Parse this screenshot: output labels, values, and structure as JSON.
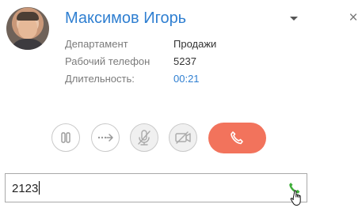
{
  "contact": {
    "name": "Максимов Игорь",
    "fields": [
      {
        "label": "Департамент",
        "value": "Продажи"
      },
      {
        "label": "Рабочий телефон",
        "value": "5237"
      },
      {
        "label": "Длительность:",
        "value": "00:21"
      }
    ]
  },
  "controls": [
    {
      "icon": "pause-icon"
    },
    {
      "icon": "transfer-icon"
    },
    {
      "icon": "mic-off-icon"
    },
    {
      "icon": "video-off-icon"
    },
    {
      "icon": "hangup-icon"
    }
  ],
  "dial": {
    "value": "2123"
  },
  "colors": {
    "accent": "#2f7fd1",
    "hangup": "#f2735c",
    "call_icon": "#3fae3a"
  }
}
